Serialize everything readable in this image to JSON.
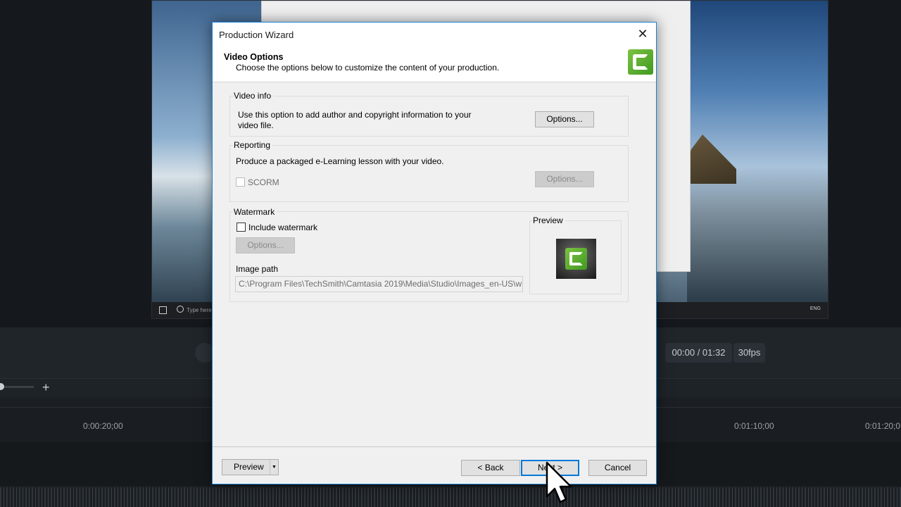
{
  "background": {
    "taskbar_search": "Type here",
    "taskbar_tray": "ENG",
    "time_display": "00:00 / 01:32",
    "fps": "30fps",
    "zoom_plus": "+",
    "ruler_ticks": [
      "0:00:20;00",
      "0:01:10;00",
      "0:01:20;0"
    ]
  },
  "dialog": {
    "title": "Production Wizard",
    "close_glyph": "✕",
    "header": {
      "title": "Video Options",
      "subtitle": "Choose the options below to customize the content of your production."
    },
    "video_info": {
      "label": "Video info",
      "description_line1": "Use this option to add author and copyright information to your",
      "description_line2": "video file.",
      "options_button": "Options..."
    },
    "reporting": {
      "label": "Reporting",
      "description": "Produce a packaged e-Learning lesson with your video.",
      "scorm_label": "SCORM",
      "scorm_checked": false,
      "options_button": "Options..."
    },
    "watermark": {
      "label": "Watermark",
      "include_label": "Include watermark",
      "include_checked": false,
      "options_button": "Options...",
      "image_path_label": "Image path",
      "image_path_value": "C:\\Program Files\\TechSmith\\Camtasia 2019\\Media\\Studio\\Images_en-US\\w",
      "preview_label": "Preview"
    },
    "footer": {
      "preview_button": "Preview",
      "preview_arrow": "▼",
      "back_button": "< Back",
      "next_button": "Next >",
      "cancel_button": "Cancel"
    }
  },
  "colors": {
    "accent": "#0078d7",
    "camtasia_green": "#5cb030"
  }
}
